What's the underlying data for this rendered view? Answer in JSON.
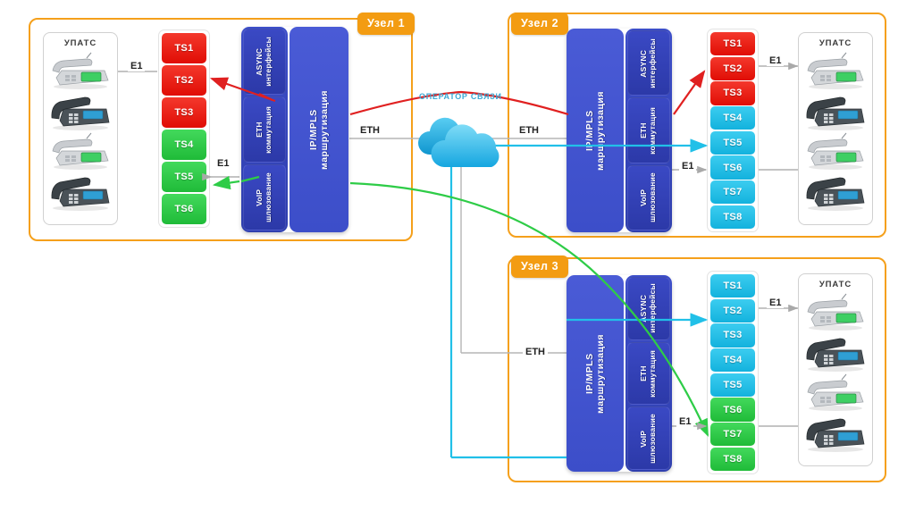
{
  "diagram": {
    "title": "",
    "network_operator_label": "ОПЕРАТОР СВЯЗИ",
    "pbx_label": "УПАТС",
    "link_labels": {
      "e1": "E1",
      "eth": "ETH"
    },
    "colors": {
      "red": "#ef1a10",
      "green": "#2ecc47",
      "cyan": "#21c0e8",
      "blue_mpls": "#3f51cf",
      "blue_submodule": "#2f3fae",
      "frame_orange": "#f5a01b",
      "badge_orange": "#f39c12",
      "cloud_blue": "#29b6e8",
      "gray_link": "#a9a9a9"
    },
    "module_labels": {
      "mpls_line1": "IP/MPLS",
      "mpls_line2": "маршрутизация",
      "async_line1": "ASYNC",
      "async_line2": "интерфейсы",
      "eth_line1": "ETH",
      "eth_line2": "коммутация",
      "voip_line1": "VoIP",
      "voip_line2": "шлюзование"
    }
  },
  "nodes": [
    {
      "id": "node1",
      "badge": "Узел 1",
      "timeslots": [
        {
          "label": "TS1",
          "color": "red"
        },
        {
          "label": "TS2",
          "color": "red"
        },
        {
          "label": "TS3",
          "color": "red"
        },
        {
          "label": "TS4",
          "color": "green"
        },
        {
          "label": "TS5",
          "color": "green"
        },
        {
          "label": "TS6",
          "color": "green"
        }
      ],
      "e1_labels": [
        "E1",
        "E1"
      ],
      "eth_label": "ETH",
      "pbx": {
        "label": "УПАТС",
        "phone_count": 4
      }
    },
    {
      "id": "node2",
      "badge": "Узел 2",
      "timeslots": [
        {
          "label": "TS1",
          "color": "red"
        },
        {
          "label": "TS2",
          "color": "red"
        },
        {
          "label": "TS3",
          "color": "red"
        },
        {
          "label": "TS4",
          "color": "cyan"
        },
        {
          "label": "TS5",
          "color": "cyan"
        },
        {
          "label": "TS6",
          "color": "cyan"
        },
        {
          "label": "TS7",
          "color": "cyan"
        },
        {
          "label": "TS8",
          "color": "cyan"
        }
      ],
      "e1_labels": [
        "E1",
        "E1"
      ],
      "eth_label": "ETH",
      "pbx": {
        "label": "УПАТС",
        "phone_count": 4
      }
    },
    {
      "id": "node3",
      "badge": "Узел 3",
      "timeslots": [
        {
          "label": "TS1",
          "color": "cyan"
        },
        {
          "label": "TS2",
          "color": "cyan"
        },
        {
          "label": "TS3",
          "color": "cyan"
        },
        {
          "label": "TS4",
          "color": "cyan"
        },
        {
          "label": "TS5",
          "color": "cyan"
        },
        {
          "label": "TS6",
          "color": "green"
        },
        {
          "label": "TS7",
          "color": "green"
        },
        {
          "label": "TS8",
          "color": "green"
        }
      ],
      "e1_labels": [
        "E1",
        "E1"
      ],
      "eth_label": "ETH",
      "pbx": {
        "label": "УПАТС",
        "phone_count": 4
      }
    }
  ],
  "cloud": {
    "label": "ОПЕРАТОР СВЯЗИ"
  },
  "flows": [
    {
      "name": "red-trunk",
      "from": "node1",
      "to": "node2",
      "color": "#e02020",
      "description": "Узел 1 TS2 ↔ Узел 2 TS2"
    },
    {
      "name": "cyan-trunk",
      "from": "node2",
      "to": "node3",
      "color": "#21c0e8",
      "description": "Узел 2 TS5 ↔ Узел 3 TS3"
    },
    {
      "name": "green-trunk",
      "from": "node1",
      "to": "node3",
      "color": "#2ecc47",
      "description": "Узел 1 TS5 ↔ Узел 3 TS7"
    }
  ]
}
